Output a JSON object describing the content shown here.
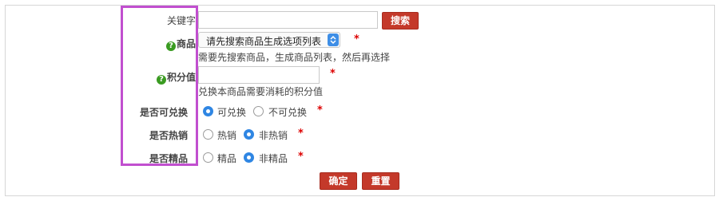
{
  "form": {
    "keyword": {
      "label": "关键字",
      "value": "",
      "search_button": "搜索"
    },
    "product": {
      "label": "商品",
      "select_value": "请先搜索商品生成选项列表",
      "required": "*",
      "hint": "需要先搜索商品，生成商品列表，然后再选择"
    },
    "points": {
      "label": "积分值",
      "value": "",
      "required": "*",
      "hint": "兑换本商品需要消耗的积分值"
    },
    "exchangeable": {
      "label": "是否可兑换",
      "options": [
        {
          "label": "可兑换",
          "selected": true
        },
        {
          "label": "不可兑换",
          "selected": false
        }
      ],
      "required": "*"
    },
    "hot": {
      "label": "是否热销",
      "options": [
        {
          "label": "热销",
          "selected": false
        },
        {
          "label": "非热销",
          "selected": true
        }
      ],
      "required": "*"
    },
    "featured": {
      "label": "是否精品",
      "options": [
        {
          "label": "精品",
          "selected": false
        },
        {
          "label": "非精品",
          "selected": true
        }
      ],
      "required": "*"
    },
    "buttons": {
      "confirm": "确定",
      "reset": "重置"
    }
  },
  "help_icon_glyph": "?",
  "colors": {
    "accent_red": "#c4392a",
    "required_star": "#dd0000",
    "radio_selected": "#2f86e3",
    "help_icon": "#3a9b21",
    "highlight_box": "#c14fcf"
  }
}
